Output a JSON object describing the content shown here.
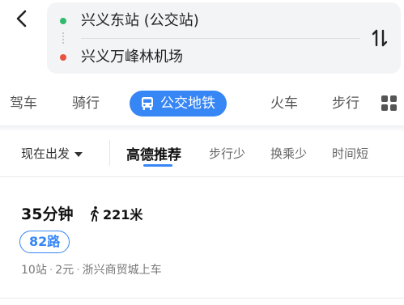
{
  "route": {
    "from": "兴义东站 (公交站)",
    "to": "兴义万峰林机场"
  },
  "modes": [
    {
      "label": "驾车"
    },
    {
      "label": "骑行"
    },
    {
      "label": "公交地铁"
    },
    {
      "label": "火车"
    },
    {
      "label": "步行"
    }
  ],
  "filters": {
    "depart_label": "现在出发",
    "options": [
      "高德推荐",
      "步行少",
      "换乘少",
      "时间短"
    ]
  },
  "result": {
    "duration": "35分钟",
    "walk_distance": "221米",
    "line": "82路",
    "stops": "10站",
    "fare": "2元",
    "board": "浙兴商贸城上车"
  },
  "colors": {
    "accent": "#3686f5",
    "start_dot": "#2fba6c",
    "end_dot": "#e8523f"
  },
  "icons": [
    "back-arrow-icon",
    "swap-icon",
    "bus-icon",
    "grid-menu-icon",
    "walking-person-icon",
    "caret-down-icon"
  ]
}
